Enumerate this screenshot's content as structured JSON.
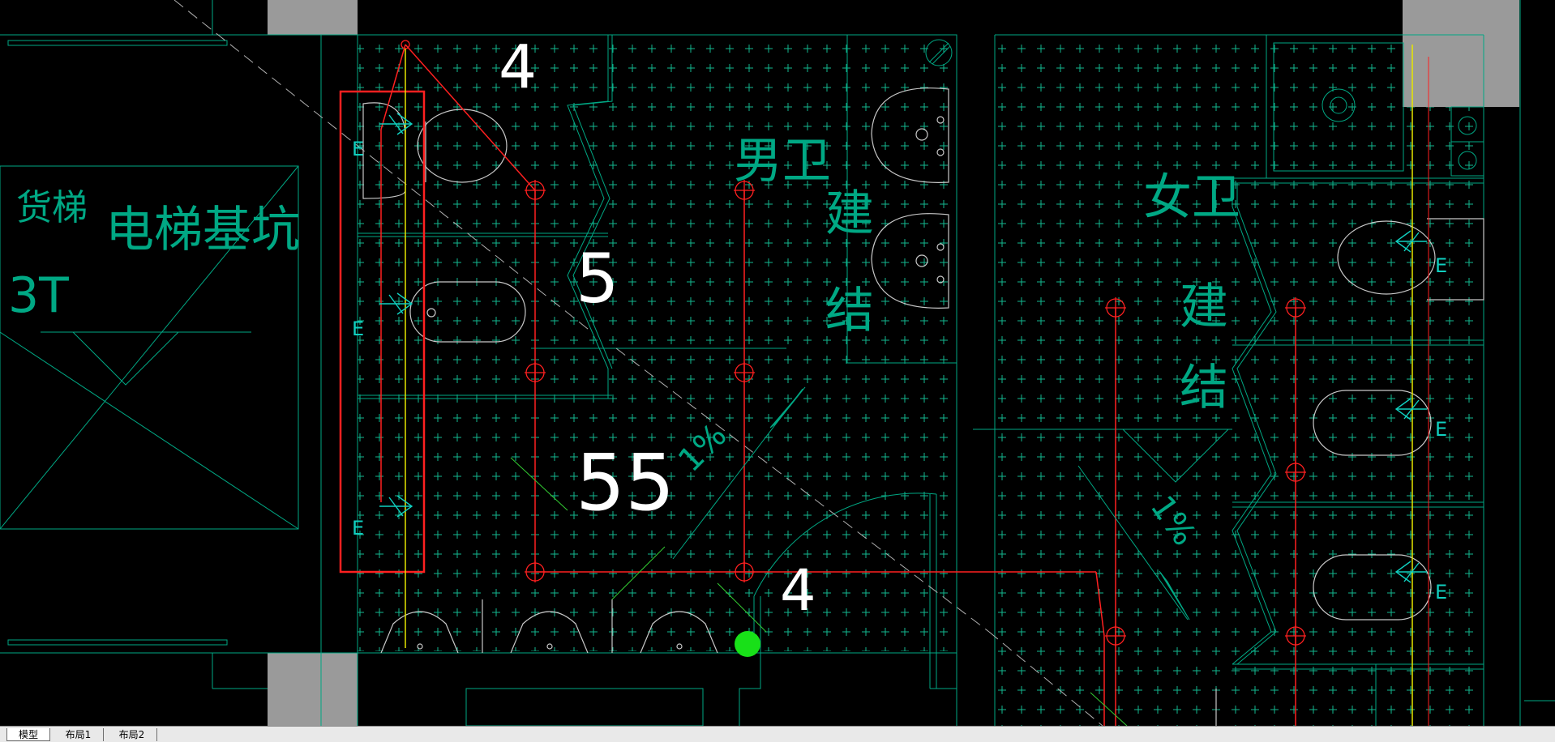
{
  "app": {
    "type": "cad-drawing-viewer"
  },
  "colors": {
    "background": "#000000",
    "cyan": "#00a884",
    "red": "#ff2020",
    "yellow": "#e6e600",
    "white": "#ffffff",
    "gray": "#9a9a9a",
    "green": "#18e018"
  },
  "drawing": {
    "labels": {
      "freight_elevator": "货梯",
      "capacity": "3T",
      "elevator_pit": "电梯基坑",
      "male_toilet": "男卫",
      "female_toilet": "女卫",
      "built_1": "建",
      "struct_1": "结",
      "built_2": "建",
      "struct_2": "结",
      "dim_4_top": "4",
      "dim_5": "5",
      "dim_55": "55",
      "dim_4_bottom": "4",
      "slope_1": "1%",
      "slope_2": "1%",
      "valve_e": "E"
    },
    "icons": [
      "fixture-point-icon",
      "urinal-icon",
      "toilet-icon",
      "sink-icon",
      "valve-arrow-icon",
      "drain-point-icon"
    ]
  },
  "tabs": [
    {
      "label": "模型",
      "active": true
    },
    {
      "label": "布局1",
      "active": false
    },
    {
      "label": "布局2",
      "active": false
    }
  ]
}
